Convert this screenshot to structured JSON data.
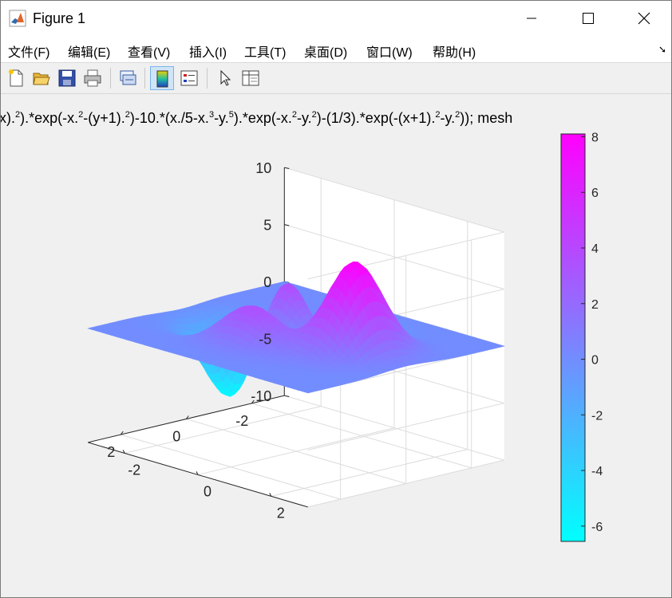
{
  "window": {
    "title": "Figure 1",
    "controls": [
      "minimize",
      "maximize",
      "close"
    ]
  },
  "menu": [
    "文件(F)",
    "编辑(E)",
    "查看(V)",
    "插入(I)",
    "工具(T)",
    "桌面(D)",
    "窗口(W)",
    "帮助(H)"
  ],
  "toolbar": {
    "icons": [
      "new-figure-icon",
      "open-file-icon",
      "save-icon",
      "print-icon",
      "link-plot-icon",
      "colorbar-toggle-icon",
      "legend-toggle-icon",
      "edit-plot-arrow-icon",
      "property-inspector-icon"
    ],
    "active": "colorbar-toggle-icon"
  },
  "plot": {
    "title_parts": [
      "-x).",
      "2",
      ").*exp(-x.",
      "2",
      "-(y+1).",
      "2",
      ")-10.*(x./5-x.",
      "3",
      "-y.",
      "5",
      ").*exp(-x.",
      "2",
      "-y.",
      "2",
      ")-(1/3).*exp(-(x+1).",
      "2",
      "-y.",
      "2",
      ")); mesh"
    ]
  },
  "chart_data": {
    "type": "surface",
    "function": "peaks",
    "x_range": [
      -3,
      3
    ],
    "y_range": [
      -3,
      3
    ],
    "zlim": [
      -10,
      10
    ],
    "ztick_labels": [
      "10",
      "5",
      "0",
      "-5",
      "-10"
    ],
    "x_tick_labels": [
      "-2",
      "0",
      "2"
    ],
    "y_tick_labels": [
      "2",
      "0",
      "-2"
    ],
    "colormap": [
      "#00ffff",
      "#ff00ff"
    ],
    "colorbar": {
      "clim": [
        -6.55,
        8.1
      ],
      "tick_labels": [
        "8",
        "6",
        "4",
        "2",
        "0",
        "-2",
        "-4",
        "-6"
      ]
    },
    "grid": true,
    "view": "3d"
  }
}
